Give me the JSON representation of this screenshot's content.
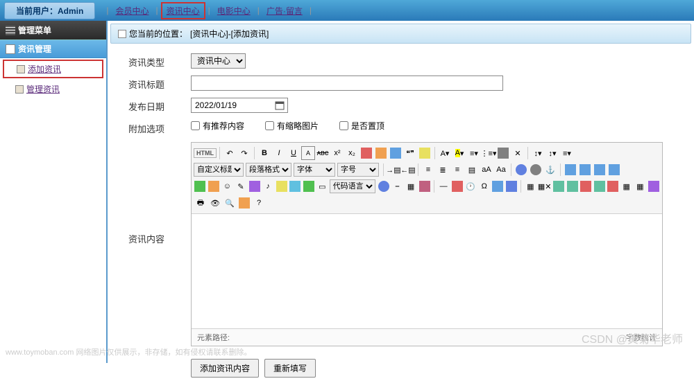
{
  "header": {
    "user_label": "当前用户：Admin",
    "tabs": [
      "会员中心",
      "资讯中心",
      "电影中心",
      "广告·留言"
    ],
    "highlighted_tab_index": 1
  },
  "sidebar": {
    "menu_title": "管理菜单",
    "section_title": "资讯管理",
    "items": [
      {
        "label": "添加资讯",
        "highlighted": true
      },
      {
        "label": "管理资讯",
        "highlighted": false
      }
    ]
  },
  "breadcrumb": {
    "prefix": "您当前的位置：",
    "path": "[资讯中心]-[添加资讯]"
  },
  "form": {
    "type": {
      "label": "资讯类型",
      "value": "资讯中心"
    },
    "title": {
      "label": "资讯标题",
      "value": ""
    },
    "date": {
      "label": "发布日期",
      "value": "2022/01/19"
    },
    "options": {
      "label": "附加选项",
      "items": [
        "有推荐内容",
        "有缩略图片",
        "是否置顶"
      ]
    },
    "content": {
      "label": "资讯内容"
    },
    "editor": {
      "selects": {
        "custom_heading": "自定义标题",
        "paragraph": "段落格式",
        "font": "字体",
        "size": "字号",
        "code_lang": "代码语言"
      },
      "footer_left": "元素路径:",
      "footer_right": "字数统计"
    },
    "buttons": {
      "submit": "添加资讯内容",
      "reset": "重新填写"
    }
  },
  "watermarks": {
    "bottom_right": "CSDN @黄菊华老师",
    "bottom_left": "www.toymoban.com 网络图片仅供展示，非存储，如有侵权请联系删除。"
  }
}
